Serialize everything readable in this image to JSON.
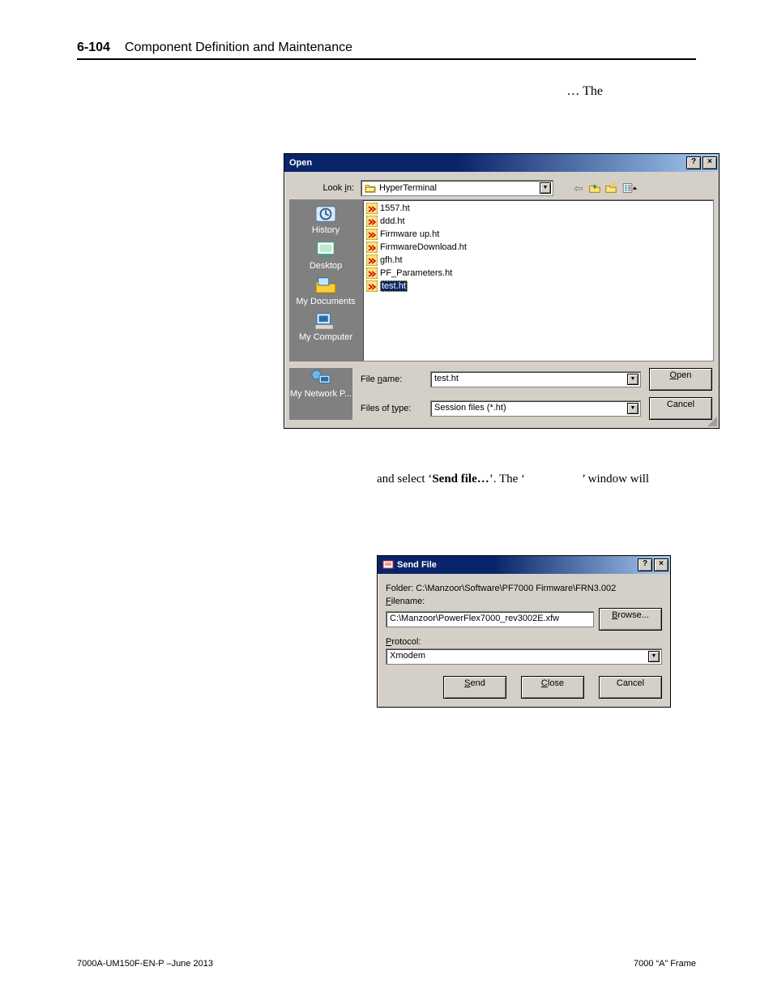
{
  "header": {
    "page_number": "6-104",
    "section_title": "Component Definition and Maintenance"
  },
  "body_text": {
    "intro_trail": "… The",
    "transfer_line_pre": "and select ‘",
    "transfer_bold": "Send file…",
    "transfer_line_mid": "’. The ‘",
    "transfer_line_post": "’ window will"
  },
  "open_dialog": {
    "title": "Open",
    "help_btn": "?",
    "close_btn": "×",
    "look_in_label": "Look in:",
    "look_in_value": "HyperTerminal",
    "toolbar": {
      "back": "←",
      "up": "up-one-level",
      "new_folder": "create-new-folder",
      "views": "views"
    },
    "places": [
      {
        "label": "History"
      },
      {
        "label": "Desktop"
      },
      {
        "label": "My Documents"
      },
      {
        "label": "My Computer"
      }
    ],
    "places_extra": {
      "label": "My Network P..."
    },
    "files": [
      {
        "name": "1557.ht",
        "selected": false
      },
      {
        "name": "ddd.ht",
        "selected": false
      },
      {
        "name": "Firmware up.ht",
        "selected": false
      },
      {
        "name": "FirmwareDownload.ht",
        "selected": false
      },
      {
        "name": "gfh.ht",
        "selected": false
      },
      {
        "name": "PF_Parameters.ht",
        "selected": false
      },
      {
        "name": "test.ht",
        "selected": true
      }
    ],
    "filename_label": "File name:",
    "filename_value": "test.ht",
    "filetype_label": "Files of type:",
    "filetype_value": "Session files (*.ht)",
    "open_btn": "Open",
    "cancel_btn": "Cancel"
  },
  "send_dialog": {
    "title": "Send File",
    "help_btn": "?",
    "close_btn": "×",
    "folder_label": "Folder:  C:\\Manzoor\\Software\\PF7000 Firmware\\FRN3.002",
    "filename_label": "Filename:",
    "filename_value": "C:\\Manzoor\\PowerFlex7000_rev3002E.xfw",
    "browse_btn": "Browse...",
    "protocol_label": "Protocol:",
    "protocol_value": "Xmodem",
    "send_btn": "Send",
    "close_btn_label": "Close",
    "cancel_btn": "Cancel"
  },
  "footer": {
    "left": "7000A-UM150F-EN-P –June 2013",
    "right": "7000 “A” Frame"
  }
}
